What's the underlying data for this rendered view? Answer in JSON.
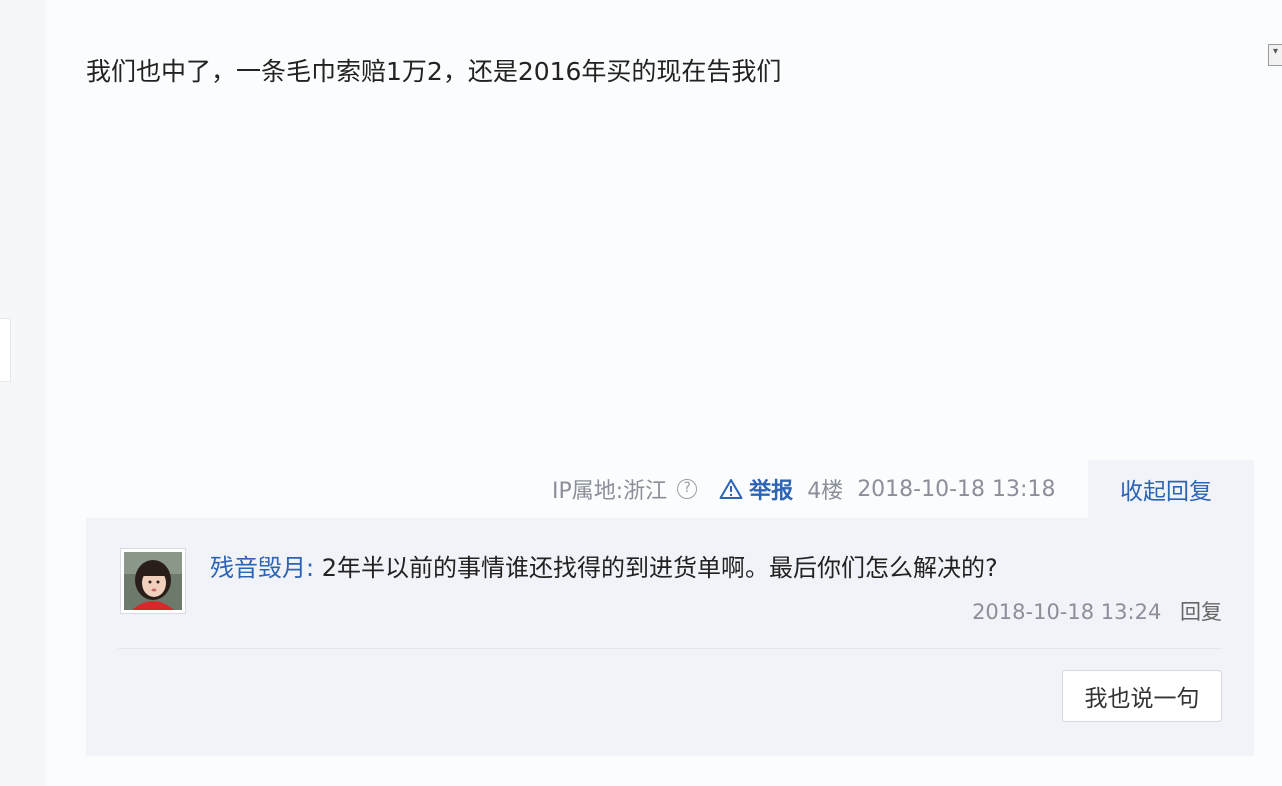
{
  "post": {
    "content": "我们也中了，一条毛巾索赔1万2，还是2016年买的现在告我们",
    "collapse_toggle_icon": "dropdown-triangle-icon",
    "footer": {
      "ip_location": "IP属地:浙江",
      "help_icon_glyph": "?",
      "report_label": "举报",
      "floor": "4楼",
      "time": "2018-10-18 13:18",
      "collapse_replies_label": "收起回复"
    }
  },
  "replies": [
    {
      "author": "残音毁月",
      "separator": ":",
      "text": " 2年半以前的事情谁还找得的到进货单啊。最后你们怎么解决的?",
      "time": "2018-10-18 13:24",
      "reply_label": "回复"
    }
  ],
  "reply_box": {
    "say_button_label": "我也说一句"
  },
  "colors": {
    "link_blue": "#2d64b3",
    "meta_gray": "#8a8f99",
    "reply_panel_bg": "#f1f3f8"
  }
}
